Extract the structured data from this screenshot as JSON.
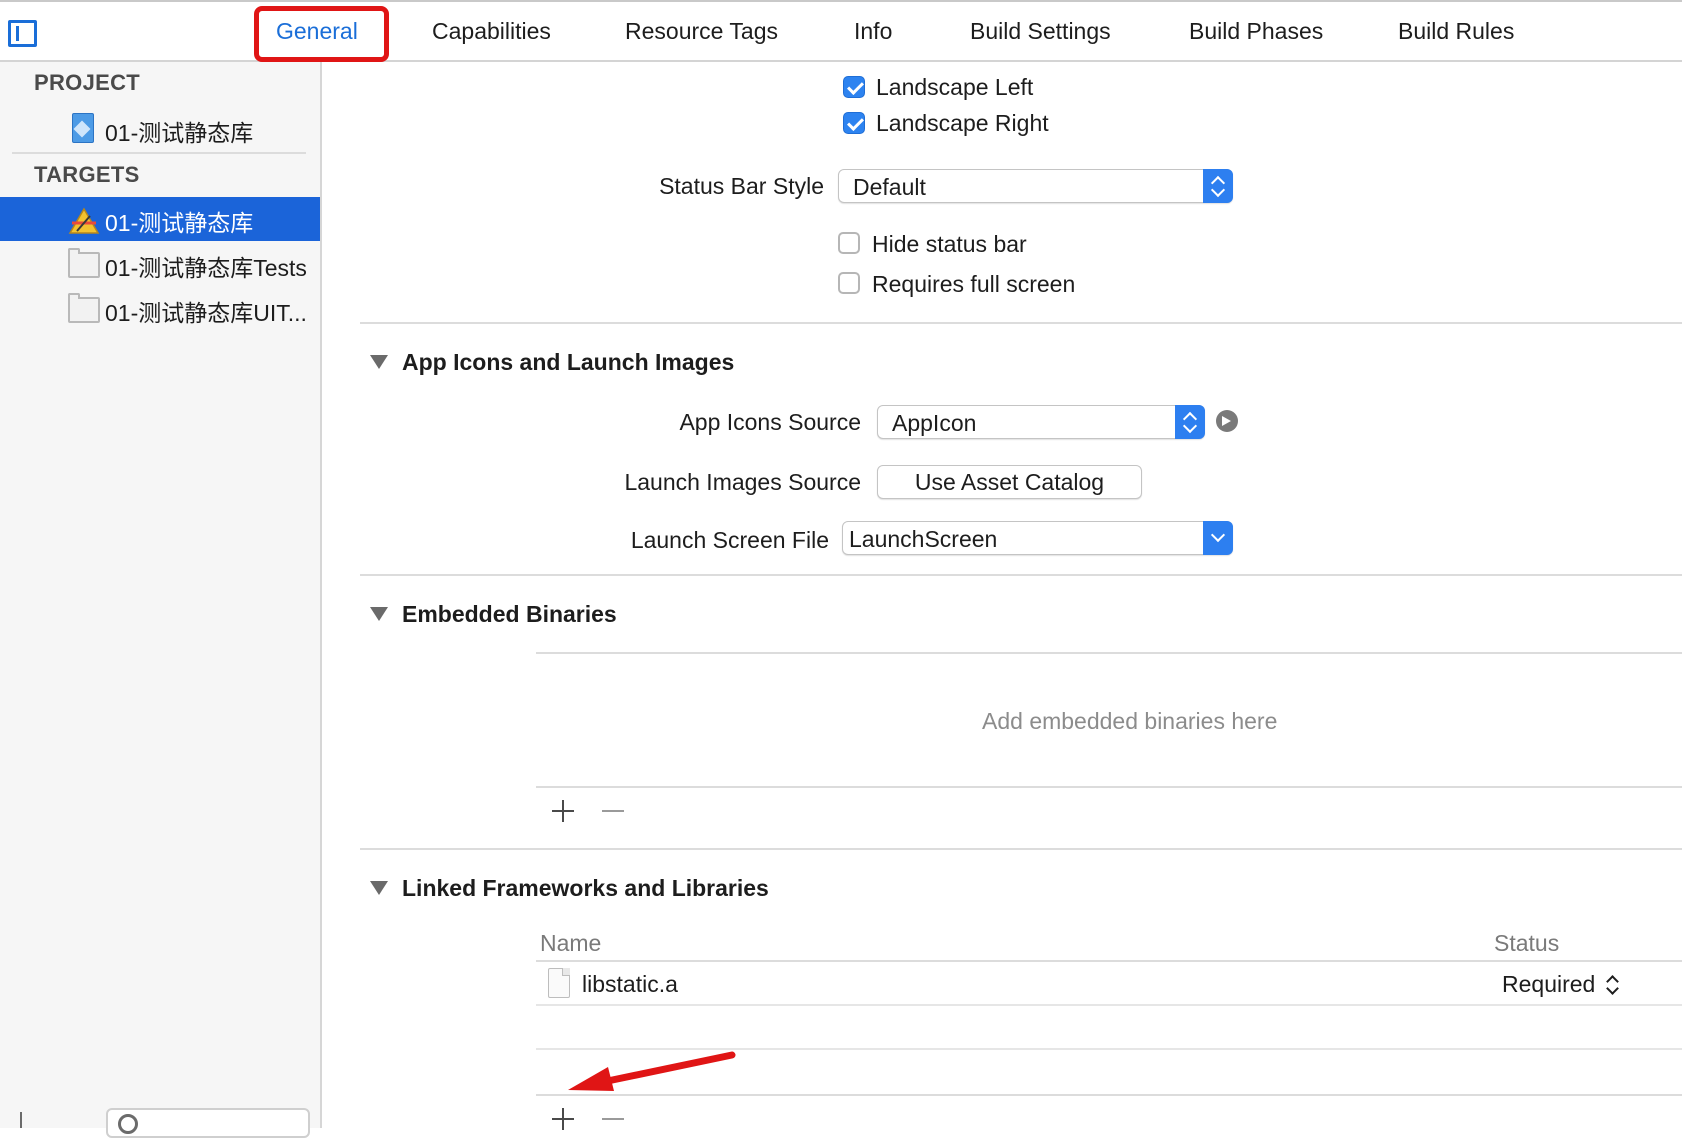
{
  "tabs": [
    {
      "label": "General",
      "active": true
    },
    {
      "label": "Capabilities"
    },
    {
      "label": "Resource Tags"
    },
    {
      "label": "Info"
    },
    {
      "label": "Build Settings"
    },
    {
      "label": "Build Phases"
    },
    {
      "label": "Build Rules"
    }
  ],
  "sidebar": {
    "project_header": "PROJECT",
    "project_item": "01-测试静态库",
    "targets_header": "TARGETS",
    "targets": [
      {
        "label": "01-测试静态库",
        "selected": true
      },
      {
        "label": "01-测试静态库Tests"
      },
      {
        "label": "01-测试静态库UIT..."
      }
    ]
  },
  "orientation": {
    "landscape_left": {
      "label": "Landscape Left",
      "checked": true
    },
    "landscape_right": {
      "label": "Landscape Right",
      "checked": true
    }
  },
  "status_bar": {
    "style_label": "Status Bar Style",
    "style_value": "Default",
    "hide_label": "Hide status bar",
    "hide_checked": false,
    "full_screen_label": "Requires full screen",
    "full_screen_checked": false
  },
  "app_icons_section": {
    "title": "App Icons and Launch Images",
    "icons_source_label": "App Icons Source",
    "icons_source_value": "AppIcon",
    "launch_images_label": "Launch Images Source",
    "launch_images_button": "Use Asset Catalog",
    "launch_screen_label": "Launch Screen File",
    "launch_screen_value": "LaunchScreen"
  },
  "embedded_binaries": {
    "title": "Embedded Binaries",
    "placeholder": "Add embedded binaries here"
  },
  "linked_frameworks": {
    "title": "Linked Frameworks and Libraries",
    "columns": {
      "name": "Name",
      "status": "Status"
    },
    "rows": [
      {
        "name": "libstatic.a",
        "status": "Required"
      }
    ]
  },
  "colors": {
    "accent": "#1a6ed8",
    "selection": "#1b64d9",
    "annotation_red": "#e01515"
  }
}
